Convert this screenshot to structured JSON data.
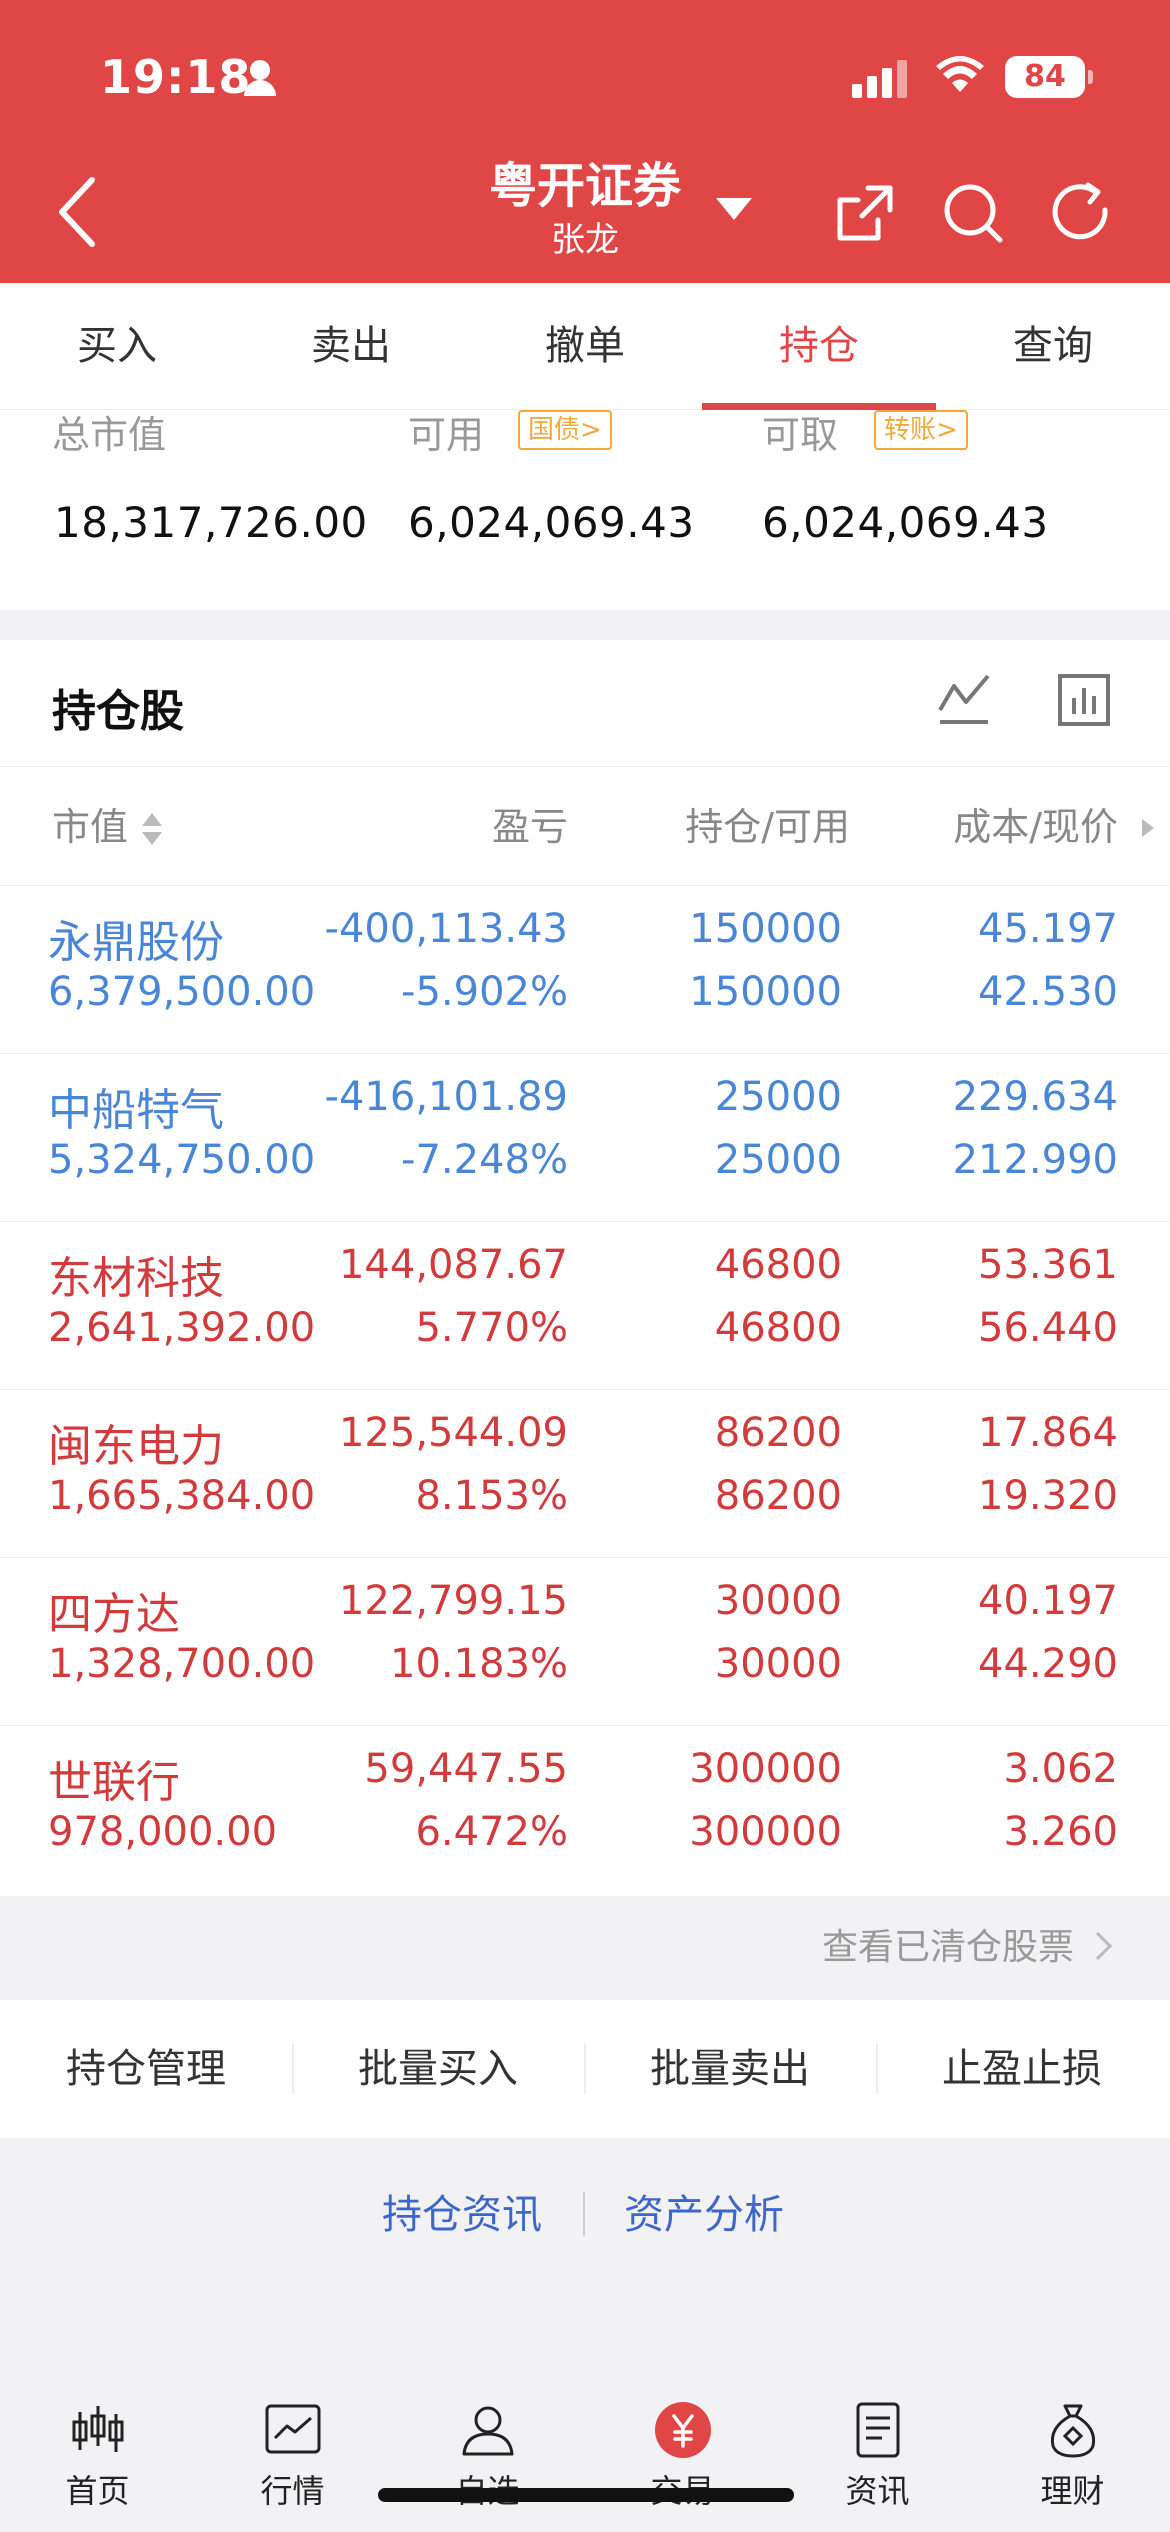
{
  "status_bar": {
    "time": "19:18",
    "battery": "84"
  },
  "header": {
    "title": "粤开证券",
    "subtitle": "张龙"
  },
  "tabs": [
    {
      "label": "买入",
      "active": false
    },
    {
      "label": "卖出",
      "active": false
    },
    {
      "label": "撤单",
      "active": false
    },
    {
      "label": "持仓",
      "active": true
    },
    {
      "label": "查询",
      "active": false
    }
  ],
  "summary": {
    "total_value_label": "总市值",
    "total_value": "18,317,726.00",
    "available_label": "可用",
    "available_tag": "国债>",
    "available": "6,024,069.43",
    "withdrawable_label": "可取",
    "withdrawable_tag": "转账>",
    "withdrawable": "6,024,069.43"
  },
  "holdings": {
    "title": "持仓股",
    "columns": [
      "市值",
      "盈亏",
      "持仓/可用",
      "成本/现价"
    ],
    "rows": [
      {
        "name": "永鼎股份",
        "market_value": "6,379,500.00",
        "pnl": "-400,113.43",
        "pnl_pct": "-5.902%",
        "position": "150000",
        "available": "150000",
        "cost": "45.197",
        "price": "42.530",
        "color": "blue"
      },
      {
        "name": "中船特气",
        "market_value": "5,324,750.00",
        "pnl": "-416,101.89",
        "pnl_pct": "-7.248%",
        "position": "25000",
        "available": "25000",
        "cost": "229.634",
        "price": "212.990",
        "color": "blue"
      },
      {
        "name": "东材科技",
        "market_value": "2,641,392.00",
        "pnl": "144,087.67",
        "pnl_pct": "5.770%",
        "position": "46800",
        "available": "46800",
        "cost": "53.361",
        "price": "56.440",
        "color": "red"
      },
      {
        "name": "闽东电力",
        "market_value": "1,665,384.00",
        "pnl": "125,544.09",
        "pnl_pct": "8.153%",
        "position": "86200",
        "available": "86200",
        "cost": "17.864",
        "price": "19.320",
        "color": "red"
      },
      {
        "name": "四方达",
        "market_value": "1,328,700.00",
        "pnl": "122,799.15",
        "pnl_pct": "10.183%",
        "position": "30000",
        "available": "30000",
        "cost": "40.197",
        "price": "44.290",
        "color": "red"
      },
      {
        "name": "世联行",
        "market_value": "978,000.00",
        "pnl": "59,447.55",
        "pnl_pct": "6.472%",
        "position": "300000",
        "available": "300000",
        "cost": "3.062",
        "price": "3.260",
        "color": "red"
      }
    ],
    "cleared_link": "查看已清仓股票"
  },
  "actions": [
    "持仓管理",
    "批量买入",
    "批量卖出",
    "止盈止损"
  ],
  "links": [
    "持仓资讯",
    "资产分析"
  ],
  "tabbar": [
    {
      "label": "首页",
      "icon": "candlestick-icon"
    },
    {
      "label": "行情",
      "icon": "chart-icon"
    },
    {
      "label": "自选",
      "icon": "person-icon"
    },
    {
      "label": "交易",
      "icon": "yuan-icon"
    },
    {
      "label": "资讯",
      "icon": "document-icon"
    },
    {
      "label": "理财",
      "icon": "money-bag-icon"
    }
  ],
  "colors": {
    "brand": "#e04646",
    "loss": "#4a86d6",
    "gain": "#d23b3b",
    "link": "#3c66c9",
    "tag": "#f0a93a"
  }
}
